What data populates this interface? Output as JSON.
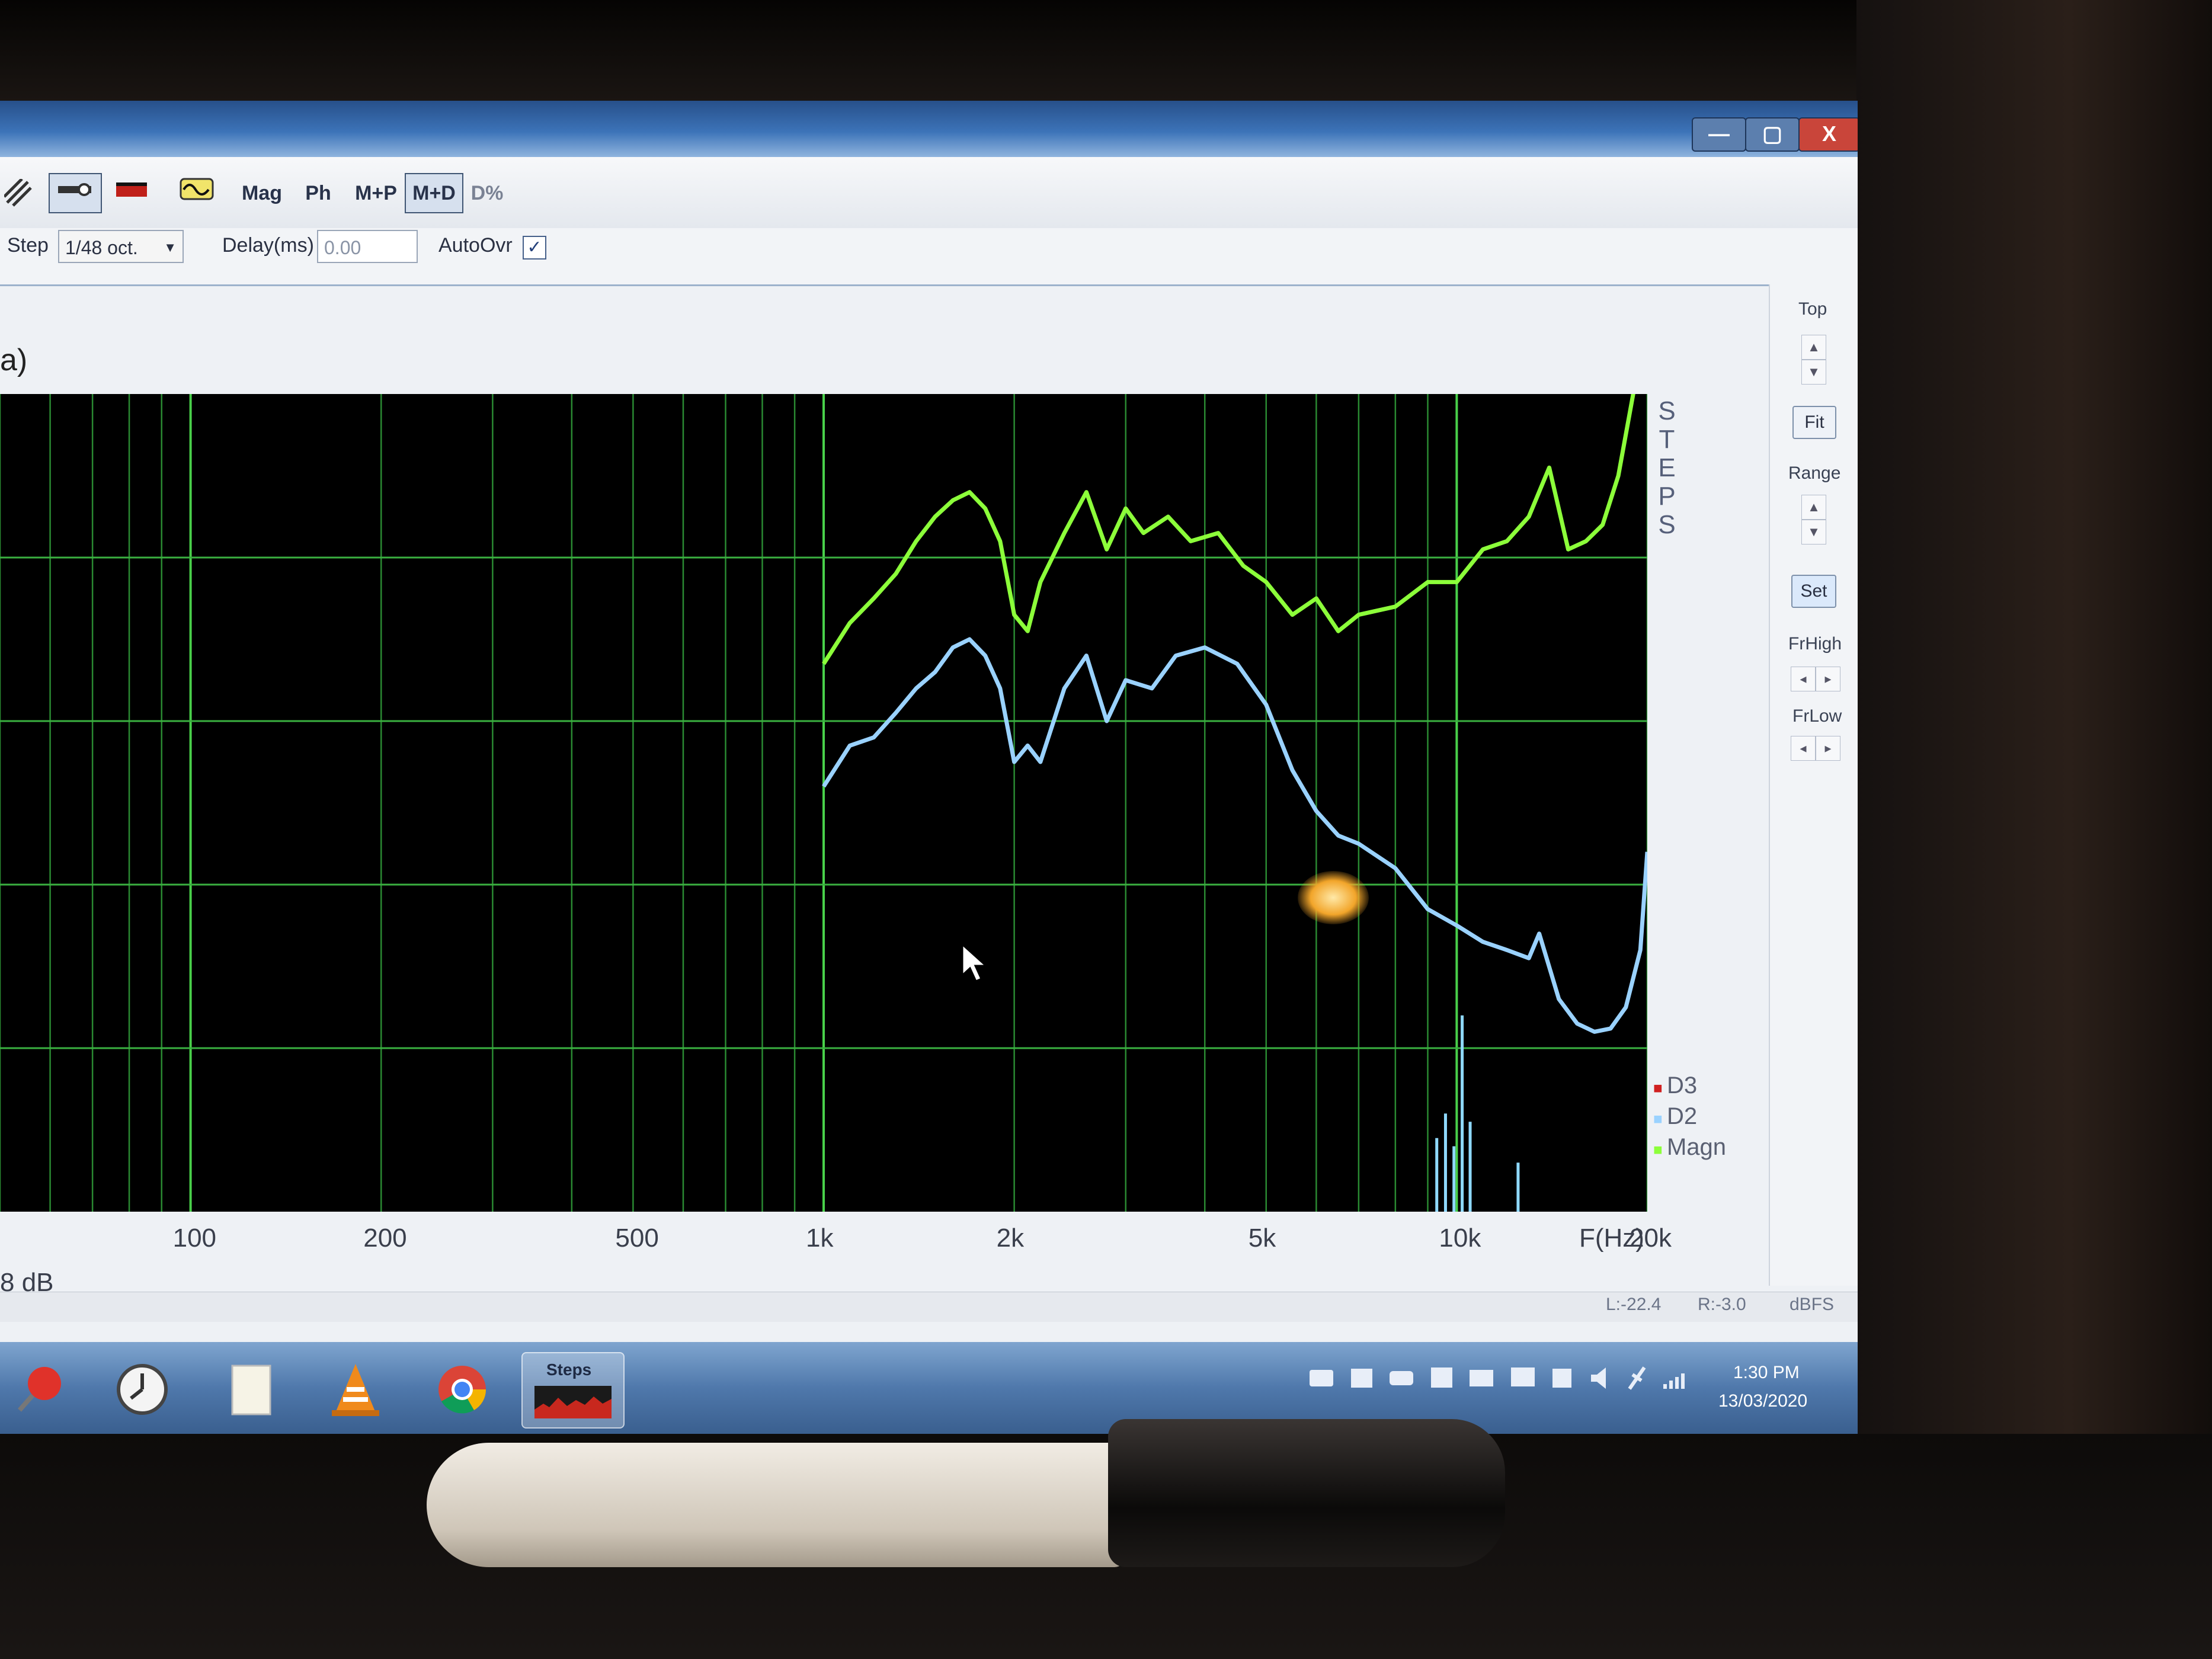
{
  "window": {
    "buttons": {
      "minimize": "—",
      "restore": "▢",
      "close": "X"
    }
  },
  "toolbar": {
    "buttons": [
      "Mag",
      "Ph",
      "M+P",
      "M+D",
      "D%"
    ],
    "selected": "M+D"
  },
  "settings": {
    "step_label": "Step",
    "step_value": "1/48 oct.",
    "delay_label": "Delay(ms)",
    "delay_value": "0.00",
    "autoovr_label": "AutoOvr",
    "autoovr_checked": true
  },
  "header_fragment": "a)",
  "side_panel": {
    "top_label": "Top",
    "fit_label": "Fit",
    "range_label": "Range",
    "set_label": "Set",
    "frhigh_label": "FrHigh",
    "frlow_label": "FrLow"
  },
  "steps_vertical": "STEPS",
  "chart_data": {
    "type": "line",
    "x_scale": "log",
    "xlabel": "F(Hz)",
    "xlim": [
      50,
      20000
    ],
    "ylim": [
      0,
      5
    ],
    "x_ticks": [
      {
        "value": 100,
        "label": "100"
      },
      {
        "value": 200,
        "label": "200"
      },
      {
        "value": 500,
        "label": "500"
      },
      {
        "value": 1000,
        "label": "1k"
      },
      {
        "value": 2000,
        "label": "2k"
      },
      {
        "value": 5000,
        "label": "5k"
      },
      {
        "value": 10000,
        "label": "10k"
      },
      {
        "value": 20000,
        "label": "20k"
      }
    ],
    "grid": true,
    "legend_position": "bottom-right",
    "legend": [
      {
        "name": "D3",
        "color": "#d02020"
      },
      {
        "name": "D2",
        "color": "#9ad2ff"
      },
      {
        "name": "Magn",
        "color": "#8cff3a"
      }
    ],
    "series": [
      {
        "name": "Magn",
        "color": "#8cff3a",
        "points": [
          [
            1000,
            3.35
          ],
          [
            1100,
            3.6
          ],
          [
            1200,
            3.75
          ],
          [
            1300,
            3.9
          ],
          [
            1400,
            4.1
          ],
          [
            1500,
            4.25
          ],
          [
            1600,
            4.35
          ],
          [
            1700,
            4.4
          ],
          [
            1800,
            4.3
          ],
          [
            1900,
            4.1
          ],
          [
            2000,
            3.65
          ],
          [
            2100,
            3.55
          ],
          [
            2200,
            3.85
          ],
          [
            2400,
            4.15
          ],
          [
            2600,
            4.4
          ],
          [
            2800,
            4.05
          ],
          [
            3000,
            4.3
          ],
          [
            3200,
            4.15
          ],
          [
            3500,
            4.25
          ],
          [
            3800,
            4.1
          ],
          [
            4200,
            4.15
          ],
          [
            4600,
            3.95
          ],
          [
            5000,
            3.85
          ],
          [
            5500,
            3.65
          ],
          [
            6000,
            3.75
          ],
          [
            6500,
            3.55
          ],
          [
            7000,
            3.65
          ],
          [
            8000,
            3.7
          ],
          [
            9000,
            3.85
          ],
          [
            10000,
            3.85
          ],
          [
            11000,
            4.05
          ],
          [
            12000,
            4.1
          ],
          [
            13000,
            4.25
          ],
          [
            14000,
            4.55
          ],
          [
            15000,
            4.05
          ],
          [
            16000,
            4.1
          ],
          [
            17000,
            4.2
          ],
          [
            18000,
            4.5
          ],
          [
            19000,
            5.0
          ],
          [
            20000,
            5.6
          ]
        ]
      },
      {
        "name": "D2",
        "color": "#9ad2ff",
        "points": [
          [
            1000,
            2.6
          ],
          [
            1100,
            2.85
          ],
          [
            1200,
            2.9
          ],
          [
            1300,
            3.05
          ],
          [
            1400,
            3.2
          ],
          [
            1500,
            3.3
          ],
          [
            1600,
            3.45
          ],
          [
            1700,
            3.5
          ],
          [
            1800,
            3.4
          ],
          [
            1900,
            3.2
          ],
          [
            2000,
            2.75
          ],
          [
            2100,
            2.85
          ],
          [
            2200,
            2.75
          ],
          [
            2400,
            3.2
          ],
          [
            2600,
            3.4
          ],
          [
            2800,
            3.0
          ],
          [
            3000,
            3.25
          ],
          [
            3300,
            3.2
          ],
          [
            3600,
            3.4
          ],
          [
            4000,
            3.45
          ],
          [
            4500,
            3.35
          ],
          [
            5000,
            3.1
          ],
          [
            5500,
            2.7
          ],
          [
            6000,
            2.45
          ],
          [
            6500,
            2.3
          ],
          [
            7000,
            2.25
          ],
          [
            8000,
            2.1
          ],
          [
            9000,
            1.85
          ],
          [
            10000,
            1.75
          ],
          [
            11000,
            1.65
          ],
          [
            12000,
            1.6
          ],
          [
            13000,
            1.55
          ],
          [
            13500,
            1.7
          ],
          [
            14500,
            1.3
          ],
          [
            15500,
            1.15
          ],
          [
            16500,
            1.1
          ],
          [
            17500,
            1.12
          ],
          [
            18500,
            1.25
          ],
          [
            19500,
            1.6
          ],
          [
            20000,
            2.2
          ]
        ]
      }
    ]
  },
  "readout": {
    "db_fragment": "8 dB",
    "left": "L:-22.4",
    "right": "R:-3.0",
    "unit": "dBFS"
  },
  "taskbar": {
    "steps_label": "Steps",
    "time": "1:30 PM",
    "date": "13/03/2020"
  }
}
